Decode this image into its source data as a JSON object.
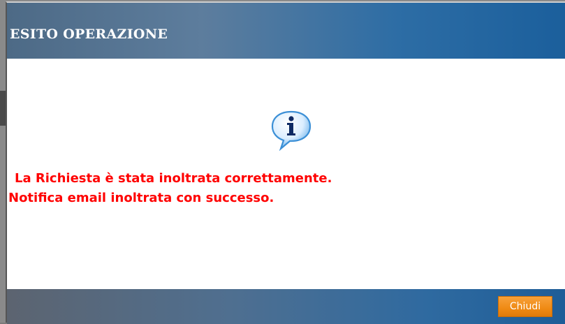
{
  "dialog": {
    "title": "ESITO OPERAZIONE",
    "icon": "info-speech-bubble-icon",
    "message": {
      "line1": "La Richiesta è stata inoltrata correttamente.",
      "line2": "Notifica email inoltrata con successo."
    },
    "close_label": "Chiudi"
  },
  "colors": {
    "title_bar": "#2d6da5",
    "message_text": "#ff0000",
    "close_button": "#ef8a14"
  }
}
